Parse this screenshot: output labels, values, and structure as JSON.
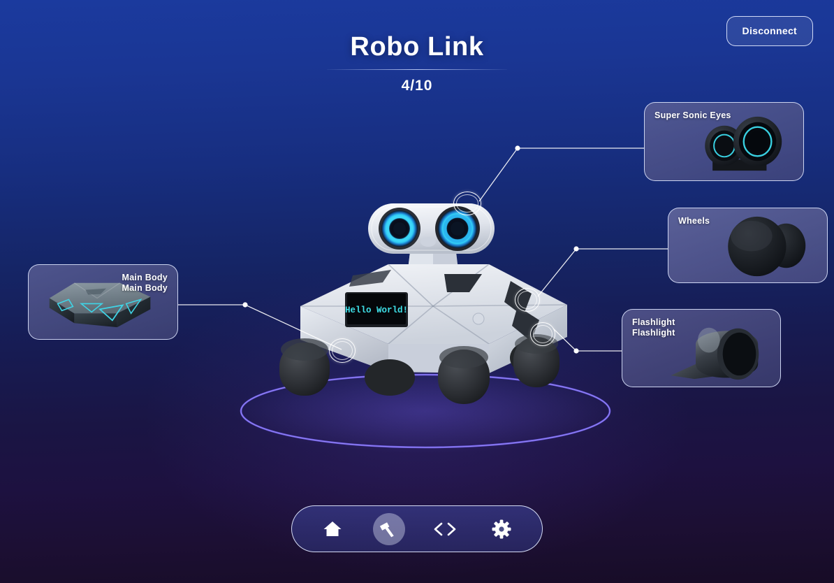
{
  "app": {
    "title": "Robo Link",
    "step_counter": "4/10"
  },
  "header": {
    "disconnect_label": "Disconnect"
  },
  "robot": {
    "display_text": "Hello World!",
    "display_color": "#3fe0e8"
  },
  "parts": [
    {
      "id": "eyes",
      "label": "Super Sonic Eyes",
      "label_lines": [
        "Super Sonic Eyes"
      ],
      "align": "left",
      "icon": "sonic-sensor-icon"
    },
    {
      "id": "wheels",
      "label": "Wheels",
      "label_lines": [
        "Wheels"
      ],
      "align": "left",
      "icon": "wheel-icon"
    },
    {
      "id": "flashlight",
      "label": "Flashlight",
      "label_lines": [
        "Flashlight",
        "Flashlight"
      ],
      "align": "left",
      "icon": "flashlight-icon"
    },
    {
      "id": "mainbody",
      "label": "Main Body",
      "label_lines": [
        "Main Body",
        "Main Body"
      ],
      "align": "right",
      "icon": "chassis-icon"
    }
  ],
  "toolbar": {
    "items": [
      {
        "id": "home",
        "icon": "home-icon",
        "active": false
      },
      {
        "id": "build",
        "icon": "hammer-icon",
        "active": true
      },
      {
        "id": "code",
        "icon": "code-icon",
        "active": false
      },
      {
        "id": "settings",
        "icon": "gear-icon",
        "active": false
      }
    ]
  },
  "colors": {
    "background_top": "#1b3a9e",
    "background_bottom": "#170c26",
    "accent_cyan": "#2fc7ee",
    "accent_purple": "#6b5ce0",
    "card_fill": "#4b4d7e",
    "line": "#ffffff"
  }
}
